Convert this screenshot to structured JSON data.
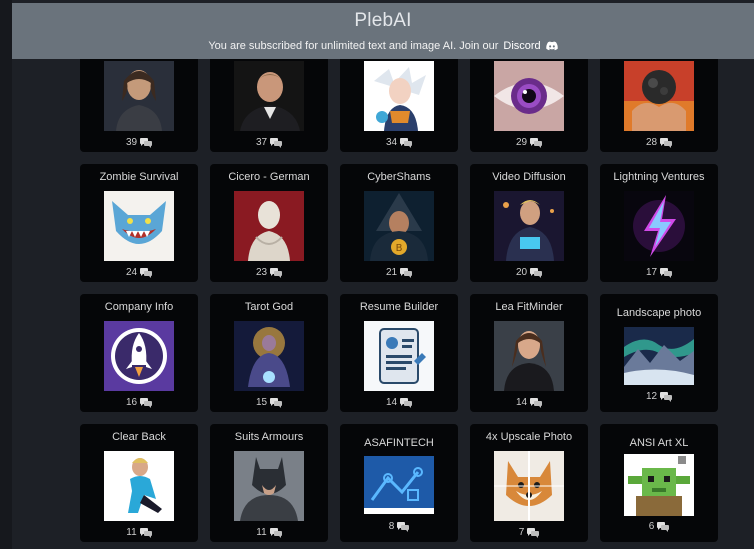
{
  "header": {
    "title": "PlebAI",
    "subscription_text": "You are subscribed for unlimited text and image AI. Join our",
    "discord_label": "Discord"
  },
  "colors": {
    "header_bg": "#6a737c",
    "page_bg": "#1d2026",
    "card_bg": "#050608"
  },
  "cards": [
    {
      "name": "",
      "count": "39",
      "icon": "woman-portrait-icon"
    },
    {
      "name": "",
      "count": "37",
      "icon": "man-portrait-icon"
    },
    {
      "name": "",
      "count": "34",
      "icon": "anime-warrior-icon"
    },
    {
      "name": "",
      "count": "29",
      "icon": "purple-eye-icon"
    },
    {
      "name": "",
      "count": "28",
      "icon": "coal-hands-icon"
    },
    {
      "name": "Zombie Survival",
      "count": "24",
      "icon": "zombie-creature-icon"
    },
    {
      "name": "Cicero - German",
      "count": "23",
      "icon": "roman-bust-icon"
    },
    {
      "name": "CyberShams",
      "count": "21",
      "icon": "bitcoin-wizard-icon"
    },
    {
      "name": "Video Diffusion",
      "count": "20",
      "icon": "glowing-man-icon"
    },
    {
      "name": "Lightning Ventures",
      "count": "17",
      "icon": "lightning-bolt-icon"
    },
    {
      "name": "Company Info",
      "count": "16",
      "icon": "rocket-logo-icon"
    },
    {
      "name": "Tarot God",
      "count": "15",
      "icon": "tarot-figure-icon"
    },
    {
      "name": "Resume Builder",
      "count": "14",
      "icon": "resume-document-icon"
    },
    {
      "name": "Lea FitMinder",
      "count": "14",
      "icon": "fitness-woman-icon"
    },
    {
      "name": "Landscape photo",
      "count": "12",
      "icon": "aurora-landscape-icon"
    },
    {
      "name": "Clear Back",
      "count": "11",
      "icon": "skater-woman-icon"
    },
    {
      "name": "Suits Armours",
      "count": "11",
      "icon": "batman-icon"
    },
    {
      "name": "ASAFINTECH",
      "count": "8",
      "icon": "fintech-logo-icon"
    },
    {
      "name": "4x Upscale Photo",
      "count": "7",
      "icon": "shiba-dog-icon"
    },
    {
      "name": "ANSI Art XL",
      "count": "6",
      "icon": "yoda-pixel-icon"
    }
  ]
}
